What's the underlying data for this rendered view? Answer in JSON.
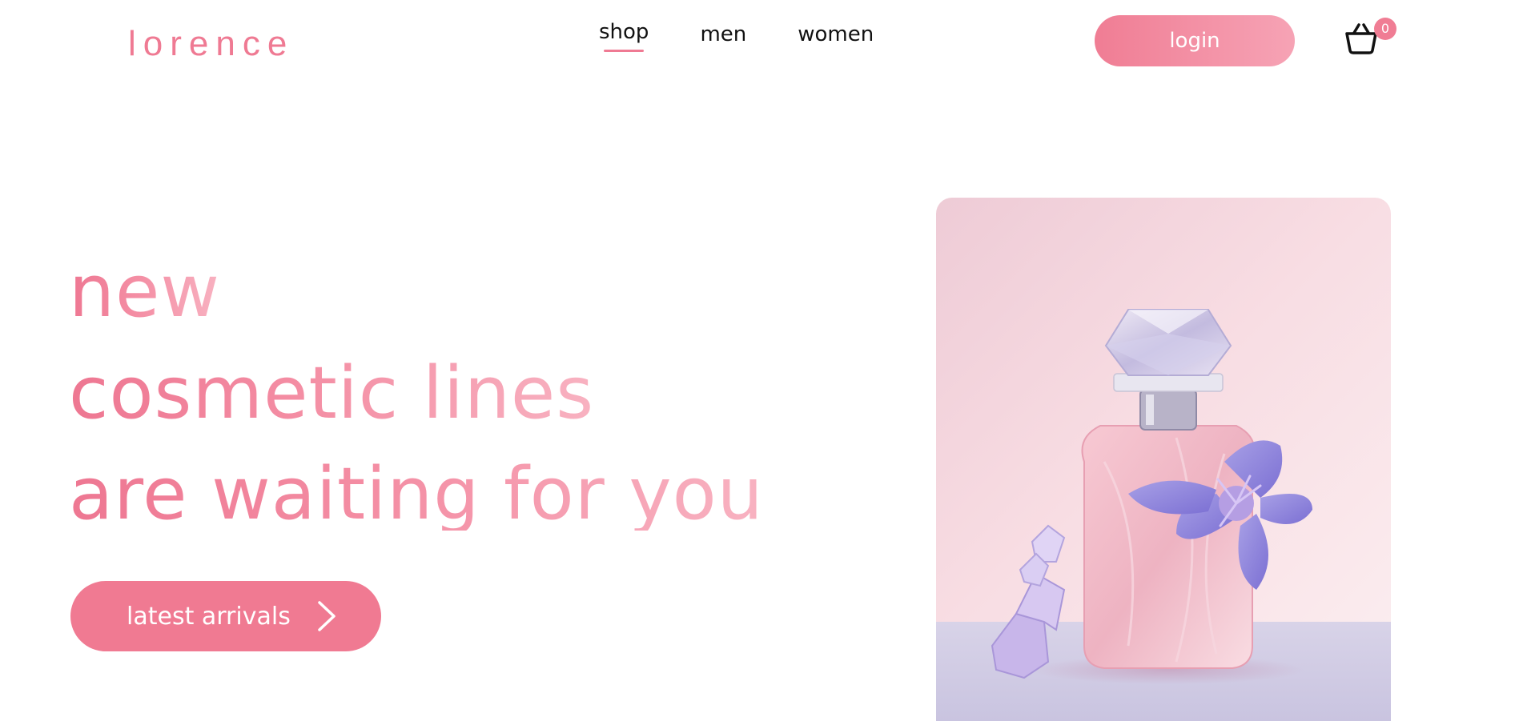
{
  "header": {
    "logo": "lorence",
    "nav": [
      {
        "label": "shop",
        "active": true
      },
      {
        "label": "men",
        "active": false
      },
      {
        "label": "women",
        "active": false
      }
    ],
    "login_label": "login",
    "cart_count": "0"
  },
  "hero": {
    "line1": "new",
    "line2": "cosmetic lines",
    "line3": "are waiting for you",
    "cta_label": "latest arrivals"
  },
  "colors": {
    "accent": "#f07a92",
    "accent_light": "#f8b2c1",
    "text": "#111111"
  },
  "icons": {
    "cart": "basket-icon",
    "cta_arrow": "chevron-right-icon"
  }
}
